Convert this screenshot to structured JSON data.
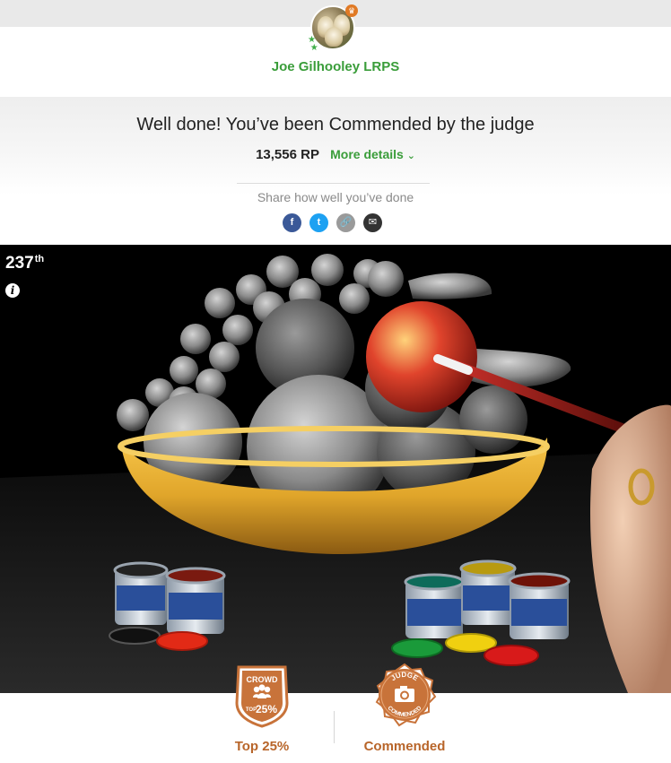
{
  "profile": {
    "name": "Joe Gilhooley LRPS"
  },
  "result": {
    "headline": "Well done! You’ve been Commended by the judge",
    "points": "13,556 RP",
    "more_details": "More details",
    "share_label": "Share how well you’ve done"
  },
  "share": [
    {
      "network": "facebook",
      "glyph": "f"
    },
    {
      "network": "twitter",
      "glyph": "t"
    },
    {
      "network": "link",
      "glyph": "🔗"
    },
    {
      "network": "email",
      "glyph": "✉"
    }
  ],
  "photo": {
    "rank_number": "237",
    "rank_suffix": "th",
    "info_glyph": "i"
  },
  "awards": {
    "crowd": {
      "badge_top": "CROWD",
      "badge_small": "TOP",
      "badge_value": "25%",
      "label": "Top 25%"
    },
    "judge": {
      "badge_top": "JUDGE",
      "badge_bottom": "COMMENDED",
      "label": "Commended"
    }
  },
  "colors": {
    "accent_green": "#3a9d3a",
    "badge_orange": "#c8733a",
    "badge_label": "#b8652a"
  }
}
